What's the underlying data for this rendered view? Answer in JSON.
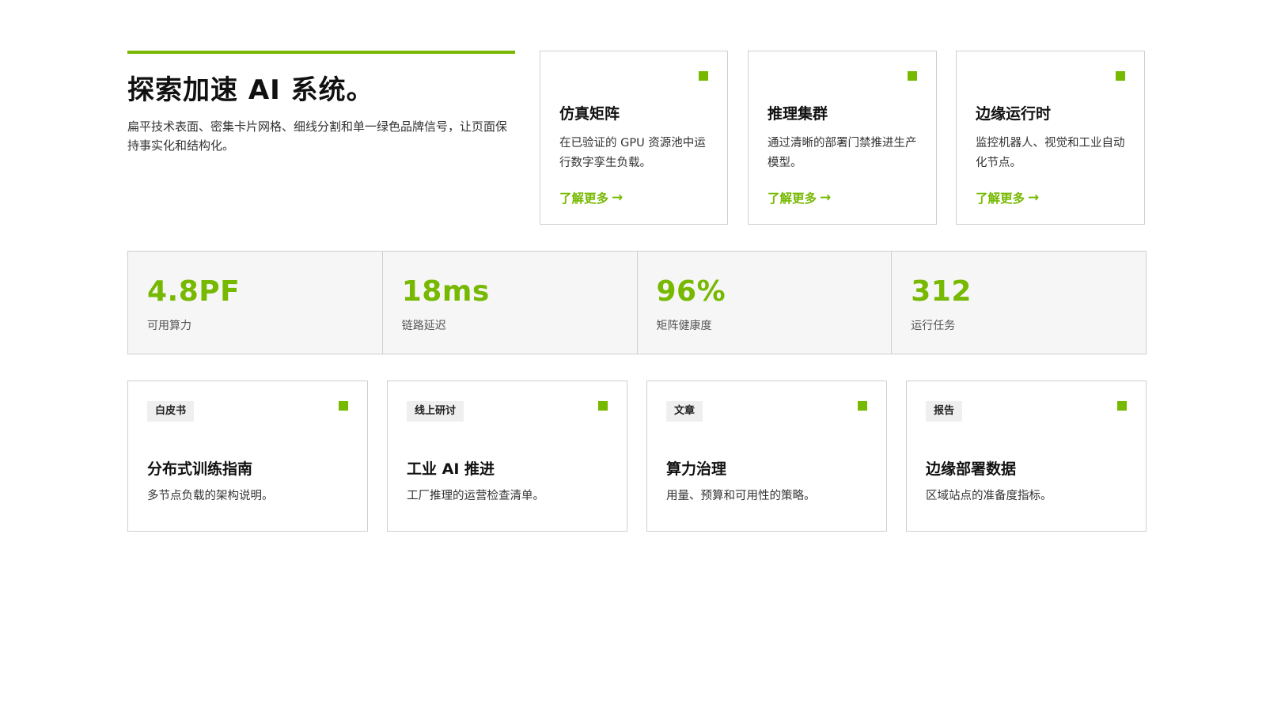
{
  "hero": {
    "title": "探索加速 AI 系统。",
    "description": "扁平技术表面、密集卡片网格、细线分割和单一绿色品牌信号，让页面保持事实化和结构化。"
  },
  "features": [
    {
      "title": "仿真矩阵",
      "description": "在已验证的 GPU 资源池中运行数字孪生负载。",
      "link": "了解更多"
    },
    {
      "title": "推理集群",
      "description": "通过清晰的部署门禁推进生产模型。",
      "link": "了解更多"
    },
    {
      "title": "边缘运行时",
      "description": "监控机器人、视觉和工业自动化节点。",
      "link": "了解更多"
    }
  ],
  "arrow_glyph": "→",
  "stats": [
    {
      "value": "4.8PF",
      "label": "可用算力"
    },
    {
      "value": "18ms",
      "label": "链路延迟"
    },
    {
      "value": "96%",
      "label": "矩阵健康度"
    },
    {
      "value": "312",
      "label": "运行任务"
    }
  ],
  "resources": [
    {
      "tag": "白皮书",
      "title": "分布式训练指南",
      "description": "多节点负载的架构说明。"
    },
    {
      "tag": "线上研讨",
      "title": "工业 AI 推进",
      "description": "工厂推理的运营检查清单。"
    },
    {
      "tag": "文章",
      "title": "算力治理",
      "description": "用量、预算和可用性的策略。"
    },
    {
      "tag": "报告",
      "title": "边缘部署数据",
      "description": "区域站点的准备度指标。"
    }
  ],
  "colors": {
    "accent": "#76b900",
    "border": "#cfcfcf",
    "stats_bg": "#f6f6f6"
  }
}
